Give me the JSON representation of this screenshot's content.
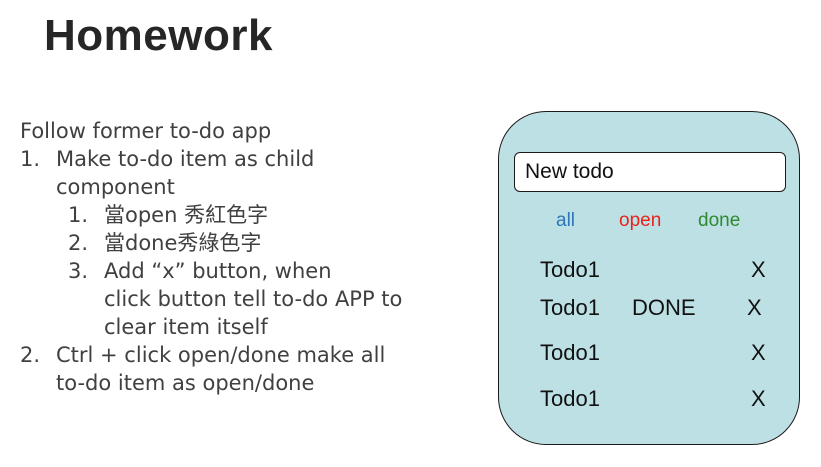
{
  "slide": {
    "title": "Homework",
    "instructions": {
      "intro": "Follow former to-do app",
      "items": [
        {
          "num": "1.",
          "lines": [
            "Make to-do item as child",
            "component"
          ],
          "subitems": [
            {
              "num": "1.",
              "lines": [
                "當open 秀紅色字"
              ]
            },
            {
              "num": "2.",
              "lines": [
                "當done秀綠色字"
              ]
            },
            {
              "num": "3.",
              "lines": [
                "Add “x” button, when",
                "click button tell to-do APP to",
                "clear item itself"
              ]
            }
          ]
        },
        {
          "num": "2.",
          "lines": [
            "Ctrl + click open/done make all",
            "to-do item as open/done"
          ]
        }
      ]
    }
  },
  "mockup": {
    "input": {
      "value": "New todo"
    },
    "filters": {
      "all": "all",
      "open": "open",
      "done": "done",
      "colors": {
        "all": "#2e75b6",
        "open": "#e8231a",
        "done": "#2f8a2f"
      }
    },
    "todos": [
      {
        "label": "Todo1",
        "status": "",
        "remove": "X"
      },
      {
        "label": "Todo1",
        "status": "DONE",
        "remove": "X"
      },
      {
        "label": "Todo1",
        "status": "",
        "remove": "X"
      },
      {
        "label": "Todo1",
        "status": "",
        "remove": "X"
      }
    ],
    "background_color": "#bde0e5"
  }
}
